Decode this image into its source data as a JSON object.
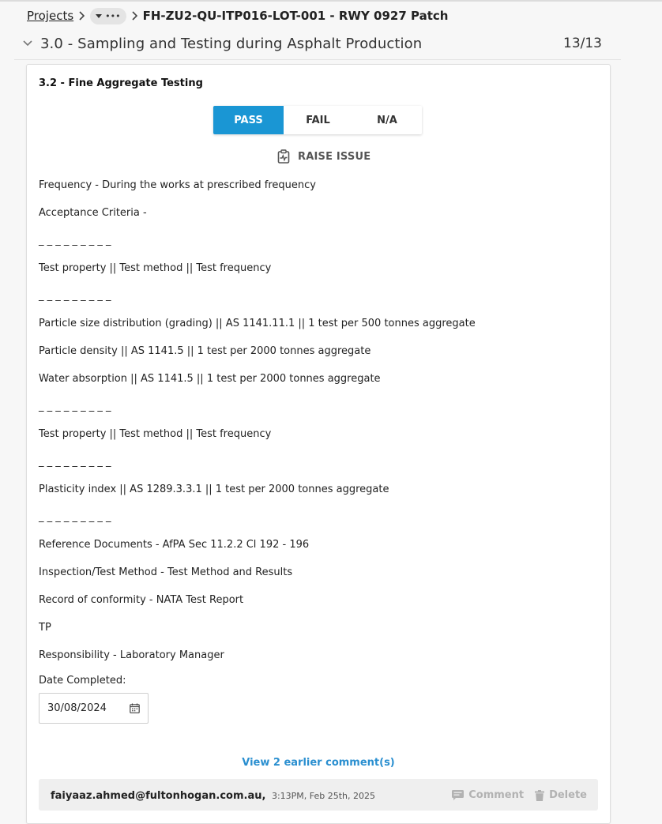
{
  "breadcrumb": {
    "projects_label": "Projects",
    "more_label": "•••",
    "current": "FH-ZU2-QU-ITP016-LOT-001 - RWY 0927 Patch"
  },
  "section": {
    "title": "3.0 - Sampling and Testing during Asphalt Production",
    "count": "13/13"
  },
  "item": {
    "title": "3.2 - Fine Aggregate Testing",
    "status_options": {
      "pass": "PASS",
      "fail": "FAIL",
      "na": "N/A",
      "selected": "PASS"
    },
    "raise_issue_label": "RAISE ISSUE",
    "lines": [
      "Frequency - During the works at prescribed frequency",
      "Acceptance Criteria -",
      "_ _ _ _ _ _ _ _ _",
      "Test property || Test method || Test frequency",
      "_ _ _ _ _ _ _ _ _",
      "Particle size distribution (grading) || AS 1141.11.1 || 1 test per 500 tonnes aggregate",
      "Particle density || AS 1141.5 || 1 test per 2000 tonnes aggregate",
      "Water absorption || AS 1141.5 || 1 test per 2000 tonnes aggregate",
      "_ _ _ _ _ _ _ _ _",
      "Test property || Test method || Test frequency",
      "_ _ _ _ _ _ _ _ _",
      "Plasticity index || AS 1289.3.3.1 || 1 test per 2000 tonnes aggregate",
      "_ _ _ _ _ _ _ _ _",
      "Reference Documents - AfPA Sec 11.2.2 Cl 192 - 196",
      "Inspection/Test Method - Test Method and Results",
      "Record of conformity - NATA Test Report",
      "TP",
      "Responsibility - Laboratory Manager"
    ],
    "date_completed_label": "Date Completed:",
    "date_completed_value": "30/08/2024"
  },
  "comments": {
    "view_earlier_label": "View 2 earlier comment(s)",
    "latest": {
      "user": "faiyaaz.ahmed@fultonhogan.com.au,",
      "time": "3:13PM, Feb 25th, 2025",
      "comment_label": "Comment",
      "delete_label": "Delete"
    }
  },
  "colors": {
    "accent": "#1a96d4",
    "link": "#2a8fd0"
  }
}
